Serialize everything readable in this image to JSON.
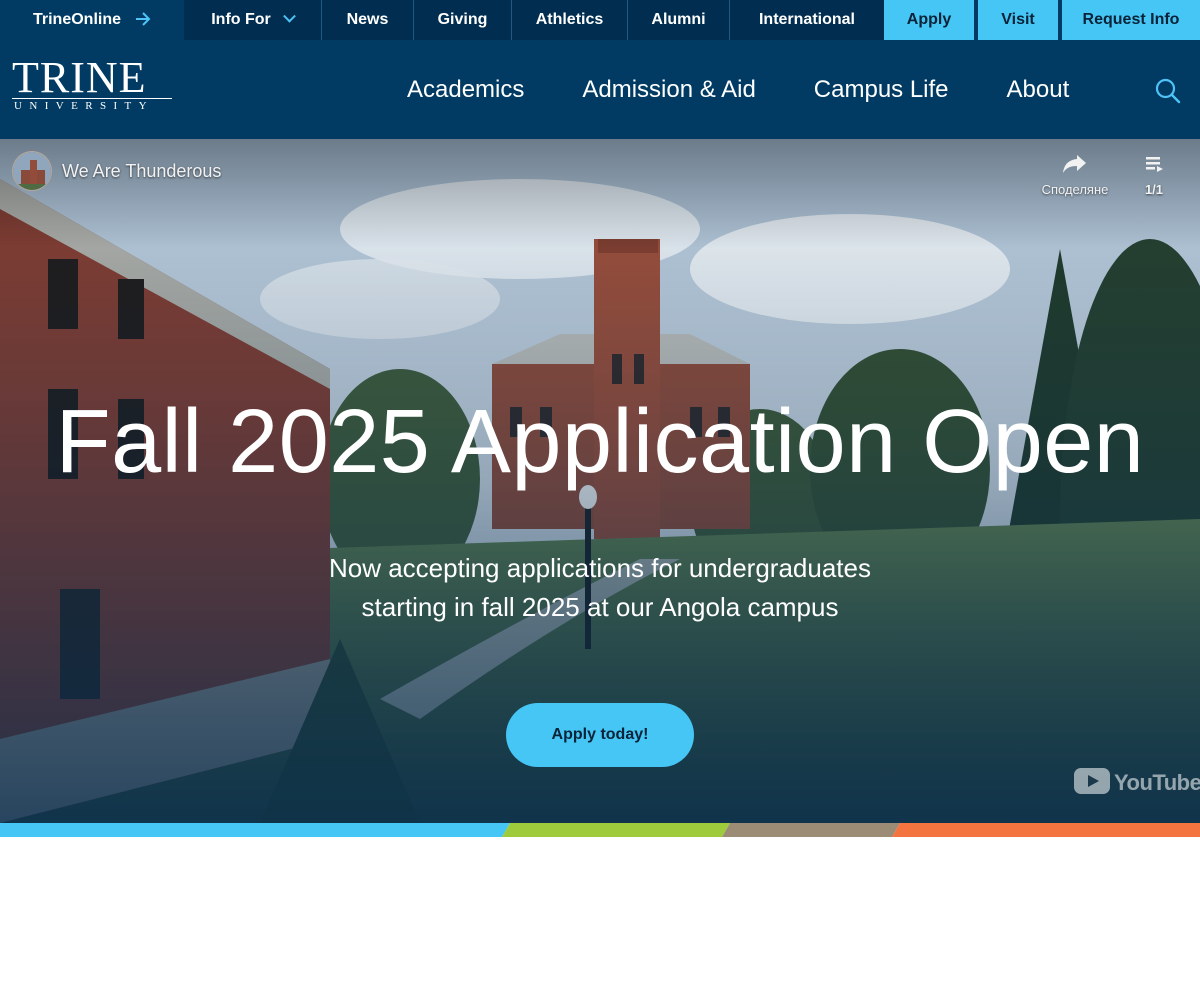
{
  "utility_nav": {
    "trine_online": "TrineOnline",
    "info_for": "Info For",
    "news": "News",
    "giving": "Giving",
    "athletics": "Athletics",
    "alumni": "Alumni",
    "international": "International",
    "apply": "Apply",
    "visit": "Visit",
    "request_info": "Request Info"
  },
  "logo": {
    "word": "TRINE",
    "sub": "UNIVERSITY"
  },
  "main_nav": [
    "Academics",
    "Admission & Aid",
    "Campus Life",
    "About"
  ],
  "video": {
    "channel": "We Are Thunderous",
    "share_label": "Споделяне",
    "playlist_count": "1/1",
    "brand": "YouTube"
  },
  "hero": {
    "title": "Fall 2025 Application Open",
    "subtitle_line1": "Now accepting applications for undergraduates",
    "subtitle_line2": "starting in fall 2025 at our Angola campus",
    "cta": "Apply today!"
  },
  "colors": {
    "navy": "#013b63",
    "navy_dark": "#012e50",
    "accent_blue": "#45c6f5",
    "stripe_green": "#9ecb3c",
    "stripe_taupe": "#9c8b75",
    "stripe_orange": "#f47440"
  },
  "icons": {
    "trine_online": "arrow-right-icon",
    "info_for": "chevron-down-icon",
    "search": "search-icon",
    "share": "share-icon",
    "playlist": "playlist-icon"
  }
}
